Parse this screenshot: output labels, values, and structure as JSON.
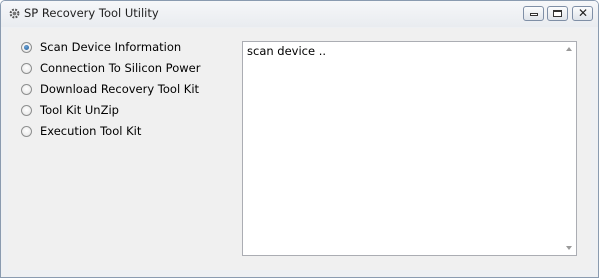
{
  "window": {
    "title": "SP Recovery Tool Utility",
    "icon": "gear-icon",
    "controls": {
      "minimize": "minimize-icon",
      "maximize": "maximize-icon",
      "close": "close-icon",
      "close_glyph": "✕"
    }
  },
  "options": [
    {
      "label": "Scan Device Information",
      "checked": true
    },
    {
      "label": "Connection To Silicon Power",
      "checked": false
    },
    {
      "label": "Download Recovery Tool Kit",
      "checked": false
    },
    {
      "label": "Tool Kit UnZip",
      "checked": false
    },
    {
      "label": "Execution Tool Kit",
      "checked": false
    }
  ],
  "log": {
    "text": "scan device .."
  },
  "colors": {
    "radio_selected": "#1d5a95",
    "border": "#abadb3",
    "window_bg": "#f0f0f0"
  }
}
